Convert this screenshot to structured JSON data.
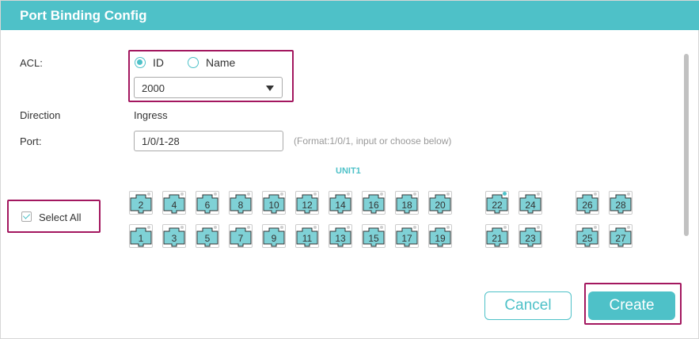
{
  "dialog": {
    "title": "Port Binding Config",
    "acl": {
      "label": "ACL:",
      "options": [
        {
          "label": "ID",
          "checked": true
        },
        {
          "label": "Name",
          "checked": false
        }
      ],
      "selected_value": "2000"
    },
    "direction": {
      "label": "Direction",
      "value": "Ingress"
    },
    "port": {
      "label": "Port:",
      "value": "1/0/1-28",
      "hint": "(Format:1/0/1, input or choose below)"
    },
    "unit_label": "UNIT1",
    "select_all": {
      "label": "Select All",
      "checked": true
    },
    "ports_top": [
      "2",
      "4",
      "6",
      "8",
      "10",
      "12",
      "14",
      "16",
      "18",
      "20",
      "22",
      "24",
      "26",
      "28"
    ],
    "ports_bottom": [
      "1",
      "3",
      "5",
      "7",
      "9",
      "11",
      "13",
      "15",
      "17",
      "19",
      "21",
      "23",
      "25",
      "27"
    ],
    "active_port": "22",
    "buttons": {
      "cancel": "Cancel",
      "create": "Create"
    }
  },
  "colors": {
    "accent": "#4ec1c8",
    "highlight": "#a3175f",
    "port_fill": "#7fd1d6"
  }
}
